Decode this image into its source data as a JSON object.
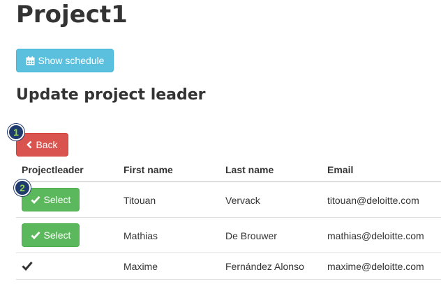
{
  "page": {
    "title": "Project1",
    "section_title": "Update project leader"
  },
  "toolbar": {
    "schedule_label": "Show schedule",
    "schedule_icon": "calendar-icon",
    "back_label": "Back",
    "back_icon": "chevron-left-icon"
  },
  "markers": [
    "1",
    "2"
  ],
  "table": {
    "headers": [
      "Projectleader",
      "First name",
      "Last name",
      "Email"
    ],
    "rows": [
      {
        "action": "Select",
        "first": "Titouan",
        "last": "Vervack",
        "email": "titouan@deloitte.com",
        "is_leader": false
      },
      {
        "action": "Select",
        "first": "Mathias",
        "last": "De Brouwer",
        "email": "mathias@deloitte.com",
        "is_leader": false
      },
      {
        "action": "",
        "first": "Maxime",
        "last": "Fernández Alonso",
        "email": "maxime@deloitte.com",
        "is_leader": true
      }
    ]
  },
  "colors": {
    "info": "#5bc0de",
    "danger": "#d9534f",
    "success": "#5cb85c",
    "marker": "#1e3a6e"
  }
}
